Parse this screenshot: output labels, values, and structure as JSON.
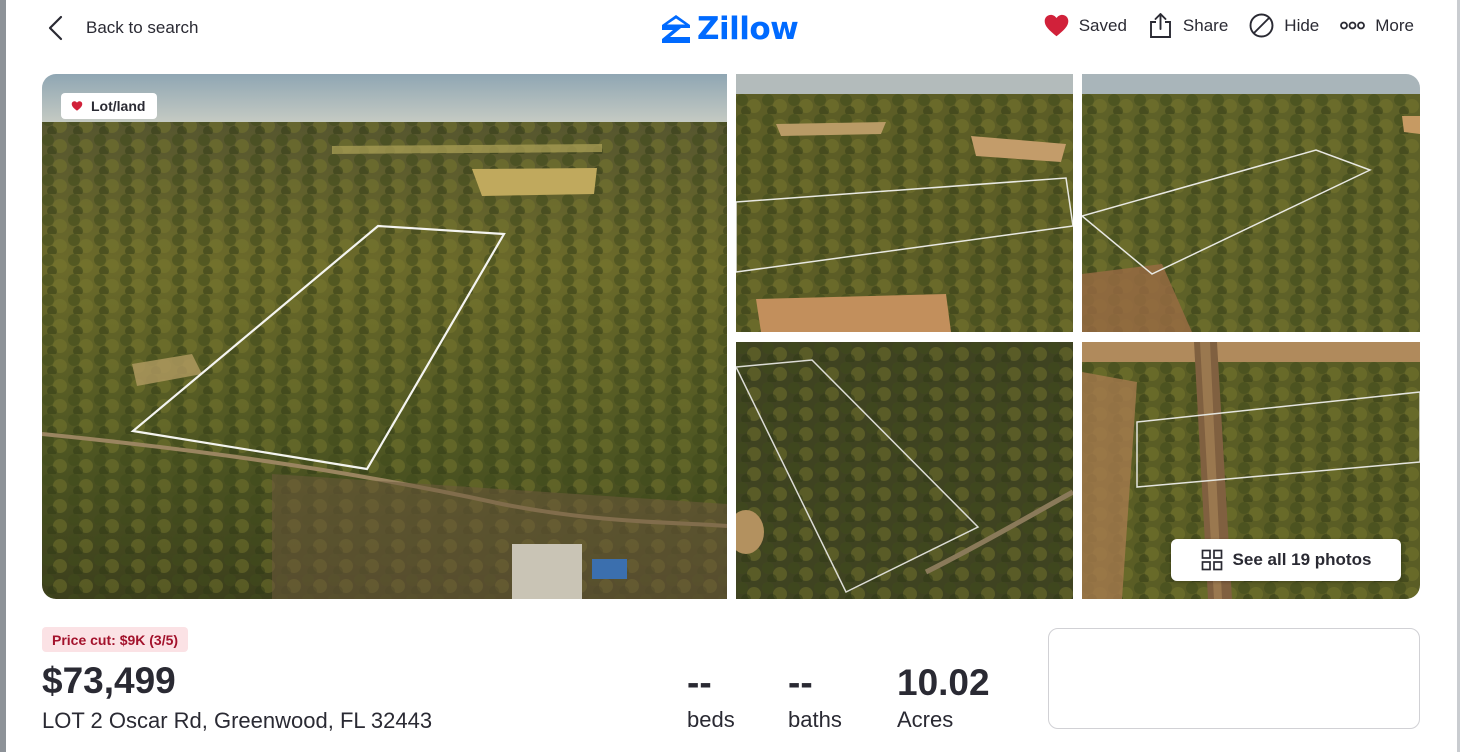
{
  "header": {
    "back_label": "Back to search",
    "logo_text": "Zillow",
    "actions": {
      "saved": "Saved",
      "share": "Share",
      "hide": "Hide",
      "more": "More"
    }
  },
  "gallery": {
    "tag_label": "Lot/land",
    "see_all_label": "See all 19 photos"
  },
  "listing": {
    "price_cut": "Price cut: $9K (3/5)",
    "price": "$73,499",
    "address": "LOT 2 Oscar Rd, Greenwood, FL 32443",
    "beds": {
      "value": "--",
      "label": "beds"
    },
    "baths": {
      "value": "--",
      "label": "baths"
    },
    "acres": {
      "value": "10.02",
      "label": "Acres"
    }
  },
  "colors": {
    "brand": "#006aff",
    "saved_heart": "#d1213a",
    "price_cut_bg": "#fbe2e5",
    "price_cut_text": "#a3122c"
  },
  "icons": {
    "back": "chevron-left-icon",
    "logo": "zillow-logo-icon",
    "saved": "heart-icon",
    "share": "share-icon",
    "hide": "hide-icon",
    "more": "more-dots-icon",
    "tag": "heart-icon",
    "see_all": "grid-icon"
  }
}
